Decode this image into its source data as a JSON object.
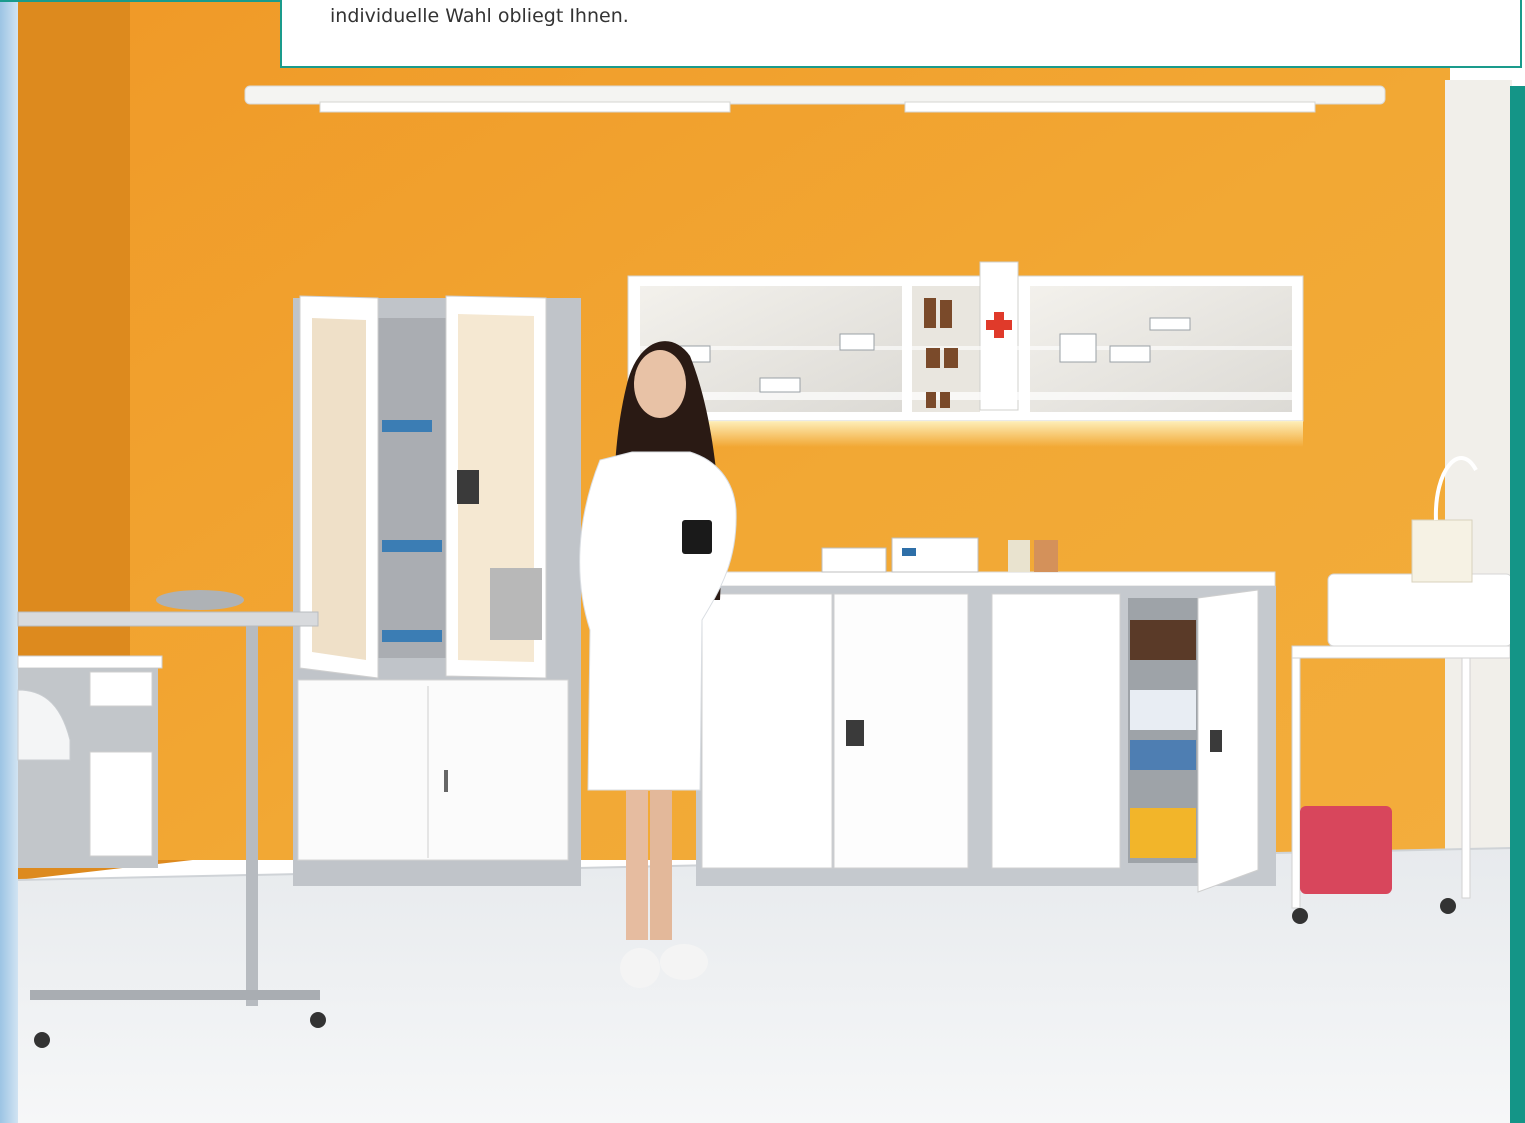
{
  "infobox": {
    "text": "individuelle Wahl obliegt Ihnen."
  },
  "colors": {
    "accent_teal": "#1a9b8c",
    "wall_orange": "#f0a030",
    "floor": "#eef0f2",
    "cabinet_white": "#fafafa",
    "cabinet_frame_grey": "#c2c6cb"
  },
  "photo": {
    "cabinet_cross_icon": "red-cross-icon"
  }
}
